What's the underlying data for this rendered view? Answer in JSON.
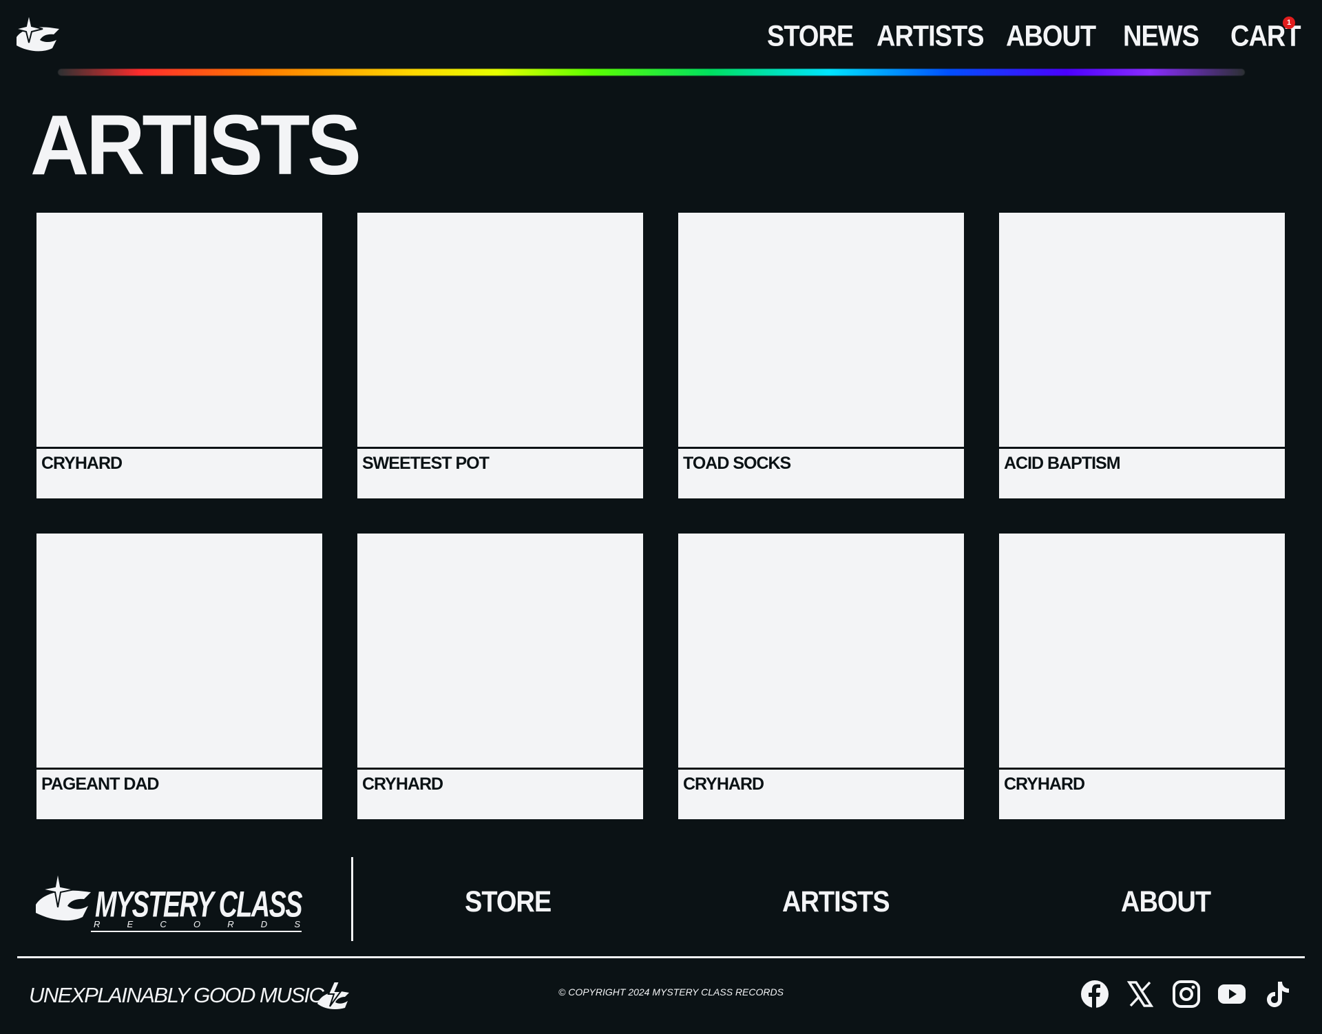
{
  "header": {
    "nav": [
      {
        "label": "STORE"
      },
      {
        "label": "ARTISTS"
      },
      {
        "label": "ABOUT"
      },
      {
        "label": "NEWS"
      },
      {
        "label": "CART"
      }
    ],
    "cart_count": "1"
  },
  "page": {
    "title": "ARTISTS"
  },
  "artists": [
    {
      "name": "CRYHARD"
    },
    {
      "name": "SWEETEST POT"
    },
    {
      "name": "TOAD SOCKS"
    },
    {
      "name": "ACID BAPTISM"
    },
    {
      "name": "PAGEANT DAD"
    },
    {
      "name": "CRYHARD"
    },
    {
      "name": "CRYHARD"
    },
    {
      "name": "CRYHARD"
    }
  ],
  "footer": {
    "logo_text": "MYSTERY CLASS",
    "logo_subtext": "R E C O R D S",
    "nav": [
      {
        "label": "STORE"
      },
      {
        "label": "ARTISTS"
      },
      {
        "label": "ABOUT"
      }
    ],
    "tagline": "UNEXPLAINABLY GOOD MUSIC.",
    "copyright": "© COPYRIGHT 2024 MYSTERY CLASS RECORDS",
    "social": [
      "facebook-icon",
      "x-icon",
      "instagram-icon",
      "youtube-icon",
      "tiktok-icon"
    ]
  },
  "colors": {
    "background": "#0b1215",
    "foreground": "#f3f4f6",
    "badge": "#e11d1d"
  }
}
